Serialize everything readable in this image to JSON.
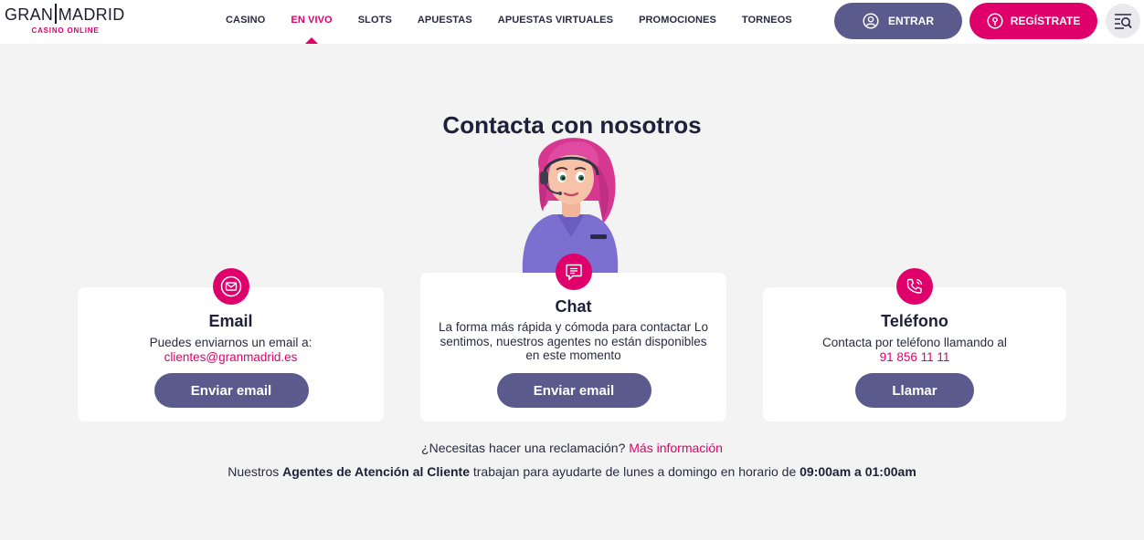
{
  "header": {
    "logo_main_left": "GRAN",
    "logo_main_right": "MADRID",
    "logo_sub": "CASINO ONLINE",
    "nav": [
      {
        "label": "CASINO",
        "active": false
      },
      {
        "label": "EN VIVO",
        "active": true
      },
      {
        "label": "SLOTS",
        "active": false
      },
      {
        "label": "APUESTAS",
        "active": false
      },
      {
        "label": "APUESTAS VIRTUALES",
        "active": false
      },
      {
        "label": "PROMOCIONES",
        "active": false
      },
      {
        "label": "TORNEOS",
        "active": false
      }
    ],
    "login_label": "ENTRAR",
    "register_label": "REGÍSTRATE"
  },
  "main": {
    "title": "Contacta con nosotros",
    "cards": {
      "email": {
        "title": "Email",
        "text": "Puedes enviarnos un email a:",
        "link": "clientes@granmadrid.es",
        "button": "Enviar email"
      },
      "chat": {
        "title": "Chat",
        "text": "La forma más rápida y cómoda para contactar Lo sentimos, nuestros agentes no están disponibles en este momento",
        "button": "Enviar email"
      },
      "phone": {
        "title": "Teléfono",
        "text": "Contacta por teléfono llamando al",
        "link": "91 856 11 11",
        "button": "Llamar"
      }
    },
    "claim_text": "¿Necesitas hacer una reclamación?",
    "claim_link": "Más información",
    "hours": {
      "part1": "Nuestros",
      "agents": "Agentes de Atención al Cliente",
      "part2": "trabajan para ayudarte de lunes a domingo en horario de",
      "time": "09:00am a 01:00am"
    }
  },
  "colors": {
    "accent": "#e0006b",
    "secondary": "#5b5a8c",
    "background": "#f3f3f4",
    "text": "#20203a"
  },
  "icons": {
    "login": "user-circle-icon",
    "register": "map-pin-icon",
    "search": "search-list-icon",
    "email": "envelope-icon",
    "chat": "chat-bubble-icon",
    "phone": "phone-ringing-icon"
  }
}
